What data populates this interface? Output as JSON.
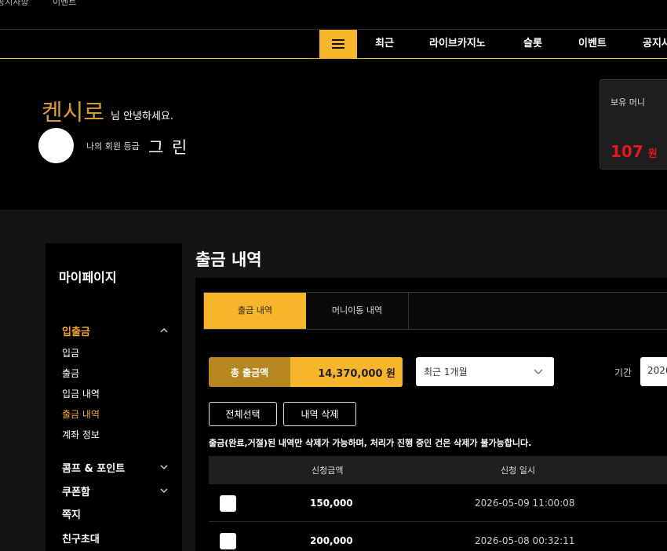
{
  "util_bar": {
    "left_link": "공지사항",
    "right_link": "이벤트"
  },
  "nav": {
    "menu_icon": "hamburger-icon",
    "items": [
      "최근",
      "라이브카지노",
      "슬롯",
      "이벤트",
      "공지사"
    ]
  },
  "profile": {
    "nickname": "켄시로",
    "greeting": "님 안녕하세요.",
    "grade_label": "나의 회원 등급",
    "grade_value": "그 린"
  },
  "money": {
    "label": "보유 머니",
    "value": "107",
    "unit": "원"
  },
  "sidebar": {
    "title": "마이페이지",
    "sections": [
      {
        "label": "입출금",
        "expanded": true,
        "items": [
          "입금",
          "출금",
          "입금 내역",
          "출금 내역",
          "계좌 정보"
        ],
        "active_item": "출금 내역"
      },
      {
        "label": "콤프 & 포인트",
        "expanded": false
      },
      {
        "label": "쿠폰함",
        "expanded": false
      },
      {
        "label": "쪽지"
      },
      {
        "label": "친구초대"
      }
    ]
  },
  "main": {
    "title": "출금 내역",
    "tabs": [
      "출금 내역",
      "머니이동 내역"
    ],
    "total_label": "총 출금액",
    "total_value": "14,370,000 원",
    "period_select": "최근 1개월",
    "period_label": "기간",
    "date_value": "2026",
    "select_all_button": "전체선택",
    "delete_button": "내역 삭제",
    "notice": "출금(완료,거절)된 내역만 삭제가 가능하며, 처리가 진행 중인 건은 삭제가 불가능합니다.",
    "table": {
      "headers": [
        "신청금액",
        "신청 일시"
      ],
      "rows": [
        {
          "amount": "150,000",
          "date": "2026-05-09 11:00:08"
        },
        {
          "amount": "200,000",
          "date": "2026-05-08 00:32:11"
        }
      ]
    }
  },
  "colors": {
    "accent": "#f7b52c",
    "accent_dark": "#b7871f",
    "nickname": "#d79a3b",
    "money": "#e3171d",
    "active_menu": "#f4a630"
  }
}
